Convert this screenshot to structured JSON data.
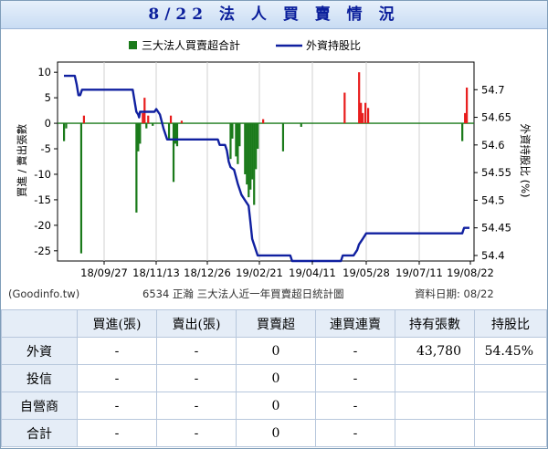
{
  "title": "8/22 法 人 買 賣 情 況",
  "chart_data": {
    "type": "bar+line",
    "legend": [
      "三大法人買賣超合計",
      "外資持股比"
    ],
    "y_left_label": "買進 / 賣出張數",
    "y_right_label": "外資持股比 (%)",
    "y_left_ticks": [
      10,
      5,
      0,
      -5,
      -10,
      -15,
      -20,
      -25
    ],
    "y_right_ticks": [
      54.7,
      54.65,
      54.6,
      54.55,
      54.5,
      54.45,
      54.4
    ],
    "ylim_left": [
      -27,
      12
    ],
    "ylim_right": [
      54.39,
      54.75
    ],
    "x_ticks": [
      "18/09/27",
      "18/11/13",
      "18/12/26",
      "19/02/21",
      "19/04/11",
      "19/05/28",
      "19/07/11",
      "19/08/22"
    ],
    "bars": [
      {
        "x": 0.0,
        "v": -3.5
      },
      {
        "x": 1.2,
        "v": -1.0
      },
      {
        "x": 9.5,
        "v": -25.5
      },
      {
        "x": 11.0,
        "v": 1.5
      },
      {
        "x": 40.0,
        "v": -17.5
      },
      {
        "x": 41.0,
        "v": -5.5
      },
      {
        "x": 42.0,
        "v": -4.0
      },
      {
        "x": 43.5,
        "v": 2.0
      },
      {
        "x": 44.5,
        "v": 5.0
      },
      {
        "x": 45.5,
        "v": -1.0
      },
      {
        "x": 46.5,
        "v": 1.5
      },
      {
        "x": 49.0,
        "v": -0.5
      },
      {
        "x": 58.0,
        "v": -3.0
      },
      {
        "x": 59.0,
        "v": 1.5
      },
      {
        "x": 60.5,
        "v": -11.5
      },
      {
        "x": 61.5,
        "v": -4.0
      },
      {
        "x": 62.5,
        "v": -4.5
      },
      {
        "x": 65.0,
        "v": 0.5
      },
      {
        "x": 92.0,
        "v": -7.0
      },
      {
        "x": 93.0,
        "v": -3.0
      },
      {
        "x": 95.0,
        "v": -6.5
      },
      {
        "x": 96.0,
        "v": -8.0
      },
      {
        "x": 97.0,
        "v": -4.5
      },
      {
        "x": 100.0,
        "v": -10.0
      },
      {
        "x": 101.0,
        "v": -12.0
      },
      {
        "x": 102.0,
        "v": -14.5
      },
      {
        "x": 103.0,
        "v": -13.0
      },
      {
        "x": 104.0,
        "v": -11.0
      },
      {
        "x": 105.0,
        "v": -16.0
      },
      {
        "x": 106.0,
        "v": -9.0
      },
      {
        "x": 107.0,
        "v": -5.0
      },
      {
        "x": 110.0,
        "v": 0.8
      },
      {
        "x": 121.0,
        "v": -5.5
      },
      {
        "x": 131.0,
        "v": -0.7
      },
      {
        "x": 155.0,
        "v": 6.0
      },
      {
        "x": 163.0,
        "v": 10.0
      },
      {
        "x": 164.0,
        "v": 4.0
      },
      {
        "x": 165.0,
        "v": 2.0
      },
      {
        "x": 166.5,
        "v": 4.0
      },
      {
        "x": 168.0,
        "v": 3.0
      },
      {
        "x": 220.0,
        "v": -3.5
      },
      {
        "x": 221.5,
        "v": 2.0
      },
      {
        "x": 222.5,
        "v": 7.0
      }
    ],
    "holding": [
      {
        "x": 0,
        "v": 54.725
      },
      {
        "x": 6,
        "v": 54.725
      },
      {
        "x": 7,
        "v": 54.71
      },
      {
        "x": 8,
        "v": 54.69
      },
      {
        "x": 9,
        "v": 54.69
      },
      {
        "x": 9.5,
        "v": 54.695
      },
      {
        "x": 10,
        "v": 54.7
      },
      {
        "x": 38,
        "v": 54.7
      },
      {
        "x": 39,
        "v": 54.68
      },
      {
        "x": 40,
        "v": 54.66
      },
      {
        "x": 41,
        "v": 54.655
      },
      {
        "x": 41.5,
        "v": 54.65
      },
      {
        "x": 42,
        "v": 54.66
      },
      {
        "x": 50,
        "v": 54.66
      },
      {
        "x": 51,
        "v": 54.665
      },
      {
        "x": 52,
        "v": 54.66
      },
      {
        "x": 53,
        "v": 54.655
      },
      {
        "x": 55,
        "v": 54.63
      },
      {
        "x": 56,
        "v": 54.62
      },
      {
        "x": 57,
        "v": 54.61
      },
      {
        "x": 85,
        "v": 54.61
      },
      {
        "x": 86,
        "v": 54.6
      },
      {
        "x": 89,
        "v": 54.6
      },
      {
        "x": 90,
        "v": 54.59
      },
      {
        "x": 91,
        "v": 54.57
      },
      {
        "x": 92,
        "v": 54.56
      },
      {
        "x": 94,
        "v": 54.555
      },
      {
        "x": 96,
        "v": 54.53
      },
      {
        "x": 98,
        "v": 54.51
      },
      {
        "x": 100,
        "v": 54.5
      },
      {
        "x": 102,
        "v": 54.49
      },
      {
        "x": 103,
        "v": 54.46
      },
      {
        "x": 104,
        "v": 54.43
      },
      {
        "x": 106,
        "v": 54.41
      },
      {
        "x": 107,
        "v": 54.4
      },
      {
        "x": 108,
        "v": 54.4
      },
      {
        "x": 109,
        "v": 54.4
      },
      {
        "x": 125,
        "v": 54.4
      },
      {
        "x": 126,
        "v": 54.39
      },
      {
        "x": 153,
        "v": 54.39
      },
      {
        "x": 154,
        "v": 54.4
      },
      {
        "x": 160,
        "v": 54.4
      },
      {
        "x": 162,
        "v": 54.41
      },
      {
        "x": 163,
        "v": 54.42
      },
      {
        "x": 165,
        "v": 54.43
      },
      {
        "x": 167,
        "v": 54.44
      },
      {
        "x": 220,
        "v": 54.44
      },
      {
        "x": 221,
        "v": 54.45
      },
      {
        "x": 224,
        "v": 54.45
      }
    ]
  },
  "chart_footer": {
    "source": "(Goodinfo.tw)",
    "caption": "6534 正瀚 三大法人近一年買賣超日統計圖",
    "date": "資料日期: 08/22"
  },
  "table": {
    "headers": [
      "",
      "買進(張)",
      "賣出(張)",
      "買賣超",
      "連買連賣",
      "持有張數",
      "持股比"
    ],
    "rows": [
      {
        "label": "外資",
        "cells": [
          "-",
          "-",
          "0",
          "-",
          "43,780",
          "54.45%"
        ]
      },
      {
        "label": "投信",
        "cells": [
          "-",
          "-",
          "0",
          "-",
          "",
          ""
        ]
      },
      {
        "label": "自營商",
        "cells": [
          "-",
          "-",
          "0",
          "-",
          "",
          ""
        ]
      },
      {
        "label": "合計",
        "cells": [
          "-",
          "-",
          "0",
          "-",
          "",
          ""
        ]
      }
    ]
  },
  "colors": {
    "title": "#0a1e9b",
    "bar_positive": "#e81c1c",
    "bar_negative": "#1a7a1a",
    "holding_line": "#1020a0"
  }
}
